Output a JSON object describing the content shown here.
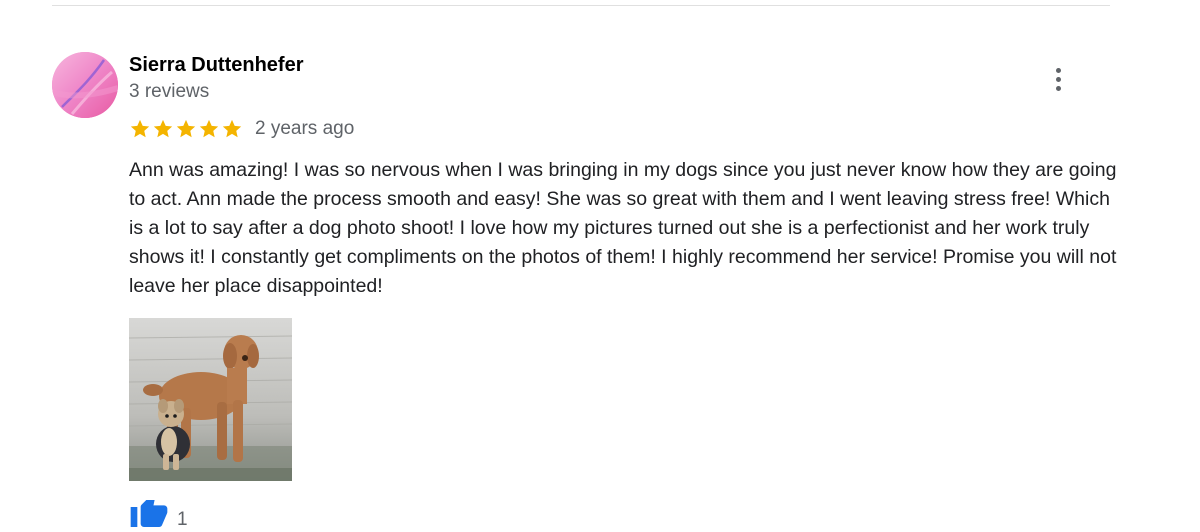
{
  "review": {
    "author": {
      "name": "Sierra Duttenhefer",
      "review_count": "3 reviews"
    },
    "rating": {
      "stars": 5,
      "max_stars": 5,
      "star_color": "#f4b400"
    },
    "time_ago": "2 years ago",
    "text": "Ann was amazing! I was so nervous when I was bringing in my dogs since you just never know how they are going to act. Ann made the process smooth and easy! She was so great with them and  I went leaving stress free! Which is a lot to say after a dog photo shoot! I love how my pictures turned out she is a perfectionist and her work truly shows it! I constantly get compliments on the photos of them! I highly recommend her service! Promise you will not leave her place disappointed!",
    "photo": {
      "subject": "two dogs sitting on a wooden deck"
    },
    "likes": {
      "count": "1",
      "icon": "thumbs-up-icon",
      "icon_color": "#1a73e8"
    },
    "menu_icon": "more-vert-icon"
  }
}
